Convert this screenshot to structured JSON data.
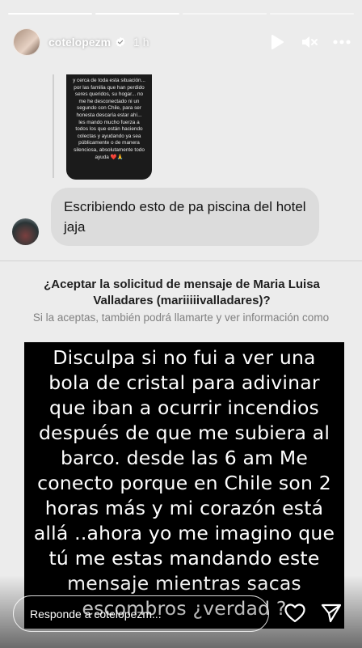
{
  "story": {
    "username": "cotelopezm",
    "time_ago": "1 h",
    "progress_segments": 4,
    "progress_completed": 2
  },
  "header_icons": [
    "play-icon",
    "mute-icon",
    "more-icon"
  ],
  "screenshot": {
    "thumb_text": "y cerca de toda esta situación... por las familia que han perdido seres queridos, su hogar... no me he desconectado ni un segundo con Chile, para ser honesta descaría estar ahí... les mando mucho fuerza a todos los que están haciendo colectas y ayudando ya sea públicamente o de manera silenciosa, absolutamente todo ayuda ❤️🙏",
    "message_text": "Escribiendo esto de pa piscina del hotel jaja",
    "request_title": "¿Aceptar la solicitud de mensaje de Maria Luisa Valladares (mariiiiivalladares)?",
    "request_subtitle": "Si la aceptas, también podrá llamarte y ver información como",
    "reply_text": "Disculpa si no fui a ver una bola de cristal para adivinar que iban a ocurrir incendios después de que me subiera al barco. desde las 6 am Me conecto porque en Chile son 2 horas más y mi corazón está allá ..ahora yo me imagino que tú me estas mandando este mensaje mientras sacas escombros ¿verdad ?"
  },
  "reply_bar": {
    "placeholder": "Responde a cotelopezm..."
  },
  "colors": {
    "background": "#ececec",
    "bubble": "#dcdcdc",
    "text_card": "#000000",
    "verified": "#ffffff"
  }
}
